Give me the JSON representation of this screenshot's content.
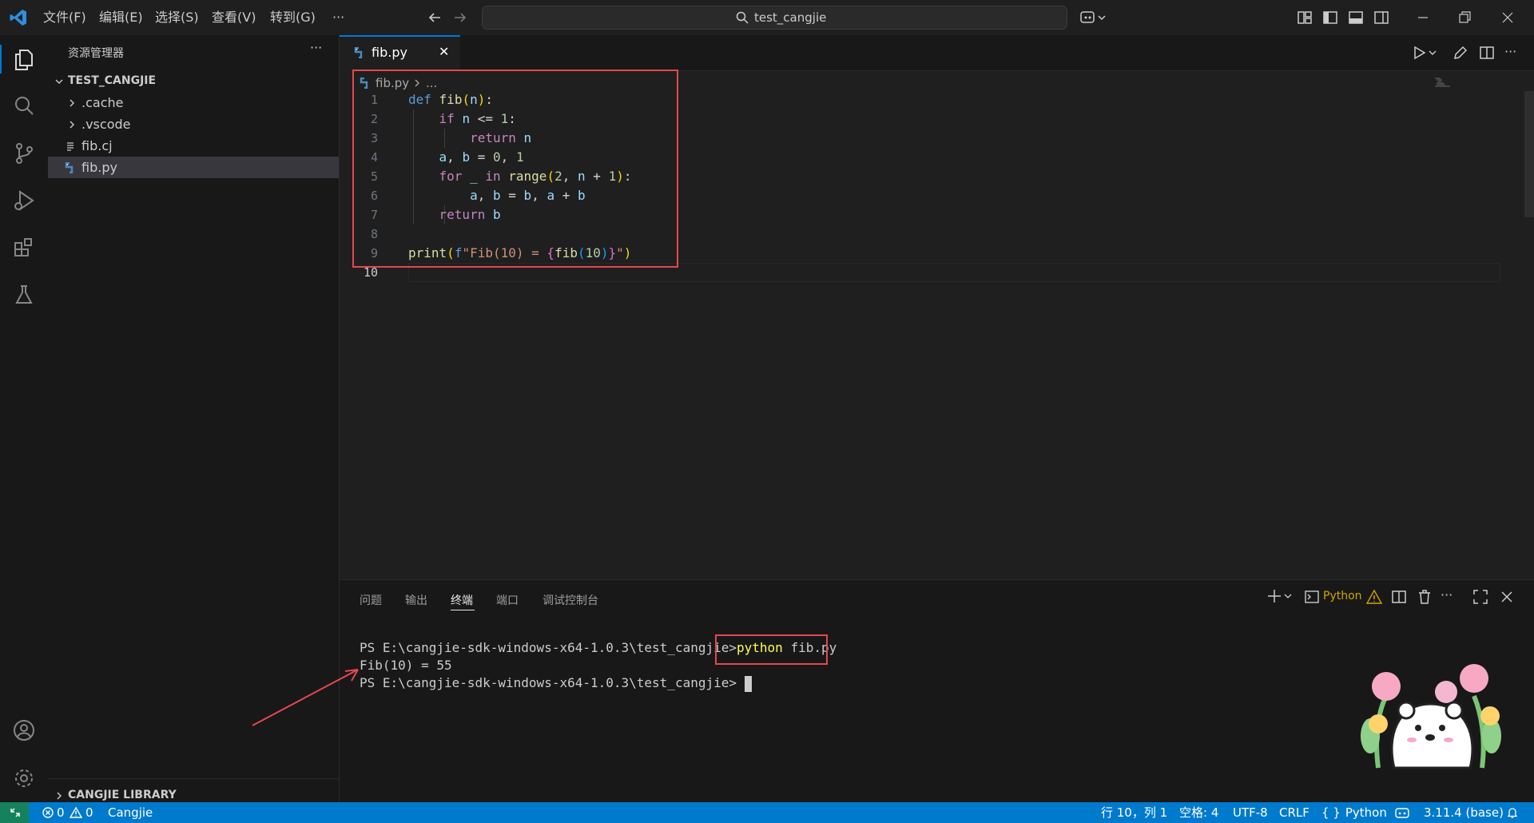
{
  "menu": [
    "文件(F)",
    "编辑(E)",
    "选择(S)",
    "查看(V)",
    "转到(G)",
    "···"
  ],
  "search": {
    "text": "test_cangjie"
  },
  "sidebar": {
    "title": "资源管理器",
    "more": "···",
    "root": "TEST_CANGJIE",
    "items": [
      {
        "label": ".cache",
        "type": "folder"
      },
      {
        "label": ".vscode",
        "type": "folder"
      },
      {
        "label": "fib.cj",
        "type": "file"
      },
      {
        "label": "fib.py",
        "type": "python"
      }
    ],
    "library": "CANGJIE LIBRARY"
  },
  "tab": {
    "label": "fib.py",
    "close": "✕"
  },
  "breadcrumb": {
    "file": "fib.py",
    "rest": "..."
  },
  "code": {
    "line_numbers": [
      "1",
      "2",
      "3",
      "4",
      "5",
      "6",
      "7",
      "8",
      "9",
      "10"
    ]
  },
  "panel": {
    "tabs": [
      "问题",
      "输出",
      "终端",
      "端口",
      "调试控制台"
    ],
    "active_tab": "终端",
    "shell_label": "Python",
    "terminal": {
      "prompt": "PS E:\\cangjie-sdk-windows-x64-1.0.3\\test_cangjie>",
      "command": "python fib.py",
      "output": "Fib(10) = 55"
    }
  },
  "statusbar": {
    "errors": "0",
    "warnings": "0",
    "project": "Cangjie",
    "position": "行 10，列 1",
    "spaces": "空格: 4",
    "encoding": "UTF-8",
    "eol": "CRLF",
    "language": "Python",
    "interpreter": "3.11.4 (base)"
  },
  "colors": {
    "accent": "#0078d4",
    "statusbar": "#007acc",
    "highlight": "#e5484d"
  }
}
